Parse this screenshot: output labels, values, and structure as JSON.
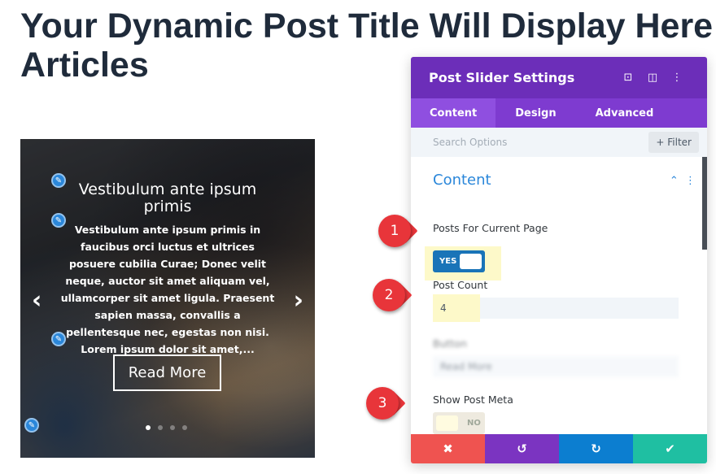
{
  "page": {
    "title_line1": "Your Dynamic Post Title Will Display Here",
    "title_line2": "Articles"
  },
  "slider": {
    "post_title": "Vestibulum ante ipsum primis",
    "excerpt": "Vestibulum ante ipsum primis in faucibus orci luctus et ultrices posuere cubilia Curae; Donec velit neque, auctor sit amet aliquam vel, ullamcorper sit amet ligula. Praesent sapien massa, convallis a pellentesque nec, egestas non nisi. Lorem ipsum dolor sit amet,...",
    "button": "Read More",
    "prev": "‹",
    "next": "›",
    "slide_count": 4,
    "active_slide": 1
  },
  "panel": {
    "title": "Post Slider Settings",
    "icons": [
      "focus-icon",
      "columns-icon",
      "more-icon"
    ],
    "tabs": [
      {
        "label": "Content",
        "active": true
      },
      {
        "label": "Design"
      },
      {
        "label": "Advanced"
      }
    ],
    "search_placeholder": "Search Options",
    "filter": "+ Filter",
    "section": "Content",
    "posts_for_current_page": {
      "label": "Posts For Current Page",
      "value": "YES"
    },
    "post_count": {
      "label": "Post Count",
      "value": "4"
    },
    "button": {
      "label": "Button",
      "value": "Read More"
    },
    "show_post_meta": {
      "label": "Show Post Meta",
      "value": "NO"
    },
    "footer": [
      "discard",
      "undo",
      "redo",
      "save"
    ]
  },
  "markers": [
    "1",
    "2",
    "3"
  ],
  "colors": {
    "header": "#6c2eb9",
    "tabs": "#7e3bd0",
    "accent": "#2b87da",
    "toggle": "#1a74b8",
    "discard": "#ef5350",
    "undo": "#7b34c1",
    "redo": "#0c7ed0",
    "save": "#1fbfa2",
    "marker": "#e8353a",
    "highlight": "#fdf9c9"
  }
}
